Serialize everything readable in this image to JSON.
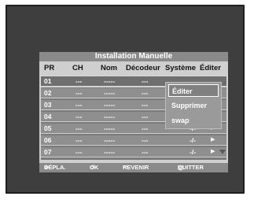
{
  "title": "Installation Manuelle",
  "columns": [
    "PR",
    "CH",
    "Nom",
    "Décodeur",
    "Système",
    "Éditer"
  ],
  "rows": [
    {
      "pr": "01",
      "ch": "---",
      "nom": "-----",
      "dec": "---",
      "sys": "",
      "arr": ""
    },
    {
      "pr": "02",
      "ch": "---",
      "nom": "-----",
      "dec": "---",
      "sys": "",
      "arr": ""
    },
    {
      "pr": "03",
      "ch": "---",
      "nom": "-----",
      "dec": "---",
      "sys": "",
      "arr": ""
    },
    {
      "pr": "04",
      "ch": "---",
      "nom": "-----",
      "dec": "---",
      "sys": "",
      "arr": ""
    },
    {
      "pr": "05",
      "ch": "---",
      "nom": "-----",
      "dec": "---",
      "sys": "-/-",
      "arr": "▶"
    },
    {
      "pr": "06",
      "ch": "---",
      "nom": "-----",
      "dec": "---",
      "sys": "-/-",
      "arr": "▶"
    },
    {
      "pr": "07",
      "ch": "---",
      "nom": "-----",
      "dec": "---",
      "sys": "-/-",
      "arr": "▶"
    }
  ],
  "popup_menu": {
    "items": [
      "Éditer",
      "Supprimer",
      "swap"
    ],
    "selected": 0
  },
  "footer": {
    "move_icon": "dpad-icon",
    "move_label": "DÉPLA.",
    "ok_icon": "enter-icon",
    "ok_label": "OK",
    "return_icon": "return-arrow-icon",
    "return_label": "REVENIR",
    "quit_icon": "menu-icon",
    "quit_label": "QUITTER"
  },
  "colors": {
    "screen_bg": "#3e3e3e",
    "panel_bg": "#cfcfcf",
    "bar_bg": "#8a8a8a",
    "row_bg": "#8f8f8f"
  }
}
